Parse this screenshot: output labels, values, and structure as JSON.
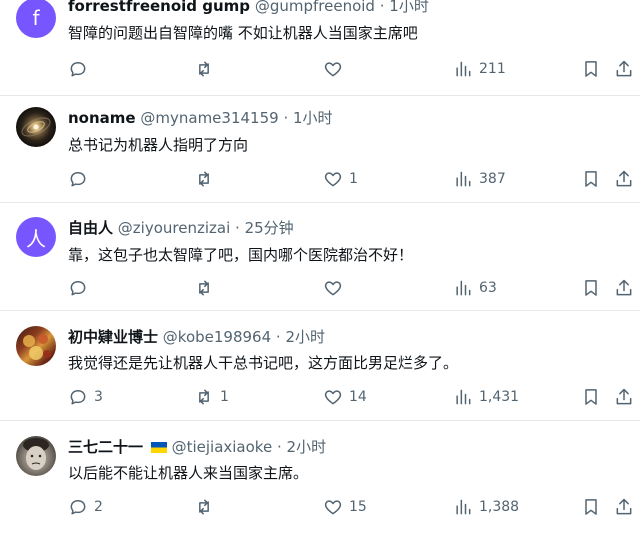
{
  "tweets": [
    {
      "name": "forrestfreenoid gump",
      "handle": "@gumpfreenoid",
      "time": "1小时",
      "avatar_letter": "f",
      "avatar_color": "#7856ff",
      "text": "智障的问题出自智障的嘴 不如让机器人当国家主席吧",
      "replies": "",
      "retweets": "",
      "likes": "",
      "views": "211"
    },
    {
      "name": "noname",
      "handle": "@myname314159",
      "time": "1小时",
      "text": "总书记为机器人指明了方向",
      "replies": "",
      "retweets": "",
      "likes": "1",
      "views": "387"
    },
    {
      "name": "自由人",
      "handle": "@ziyourenzizai",
      "time": "25分钟",
      "avatar_letter": "人",
      "avatar_color": "#7856ff",
      "text": "靠，这包子也太智障了吧，国内哪个医院都治不好！",
      "replies": "",
      "retweets": "",
      "likes": "",
      "views": "63"
    },
    {
      "name": "初中肄业博士",
      "handle": "@kobe198964",
      "time": "2小时",
      "text": "我觉得还是先让机器人干总书记吧，这方面比男足烂多了。",
      "replies": "3",
      "retweets": "1",
      "likes": "14",
      "views": "1,431"
    },
    {
      "name": "三七二十一",
      "handle": "@tiejiaxiaoke",
      "time": "2小时",
      "text": "以后能不能让机器人来当国家主席。",
      "replies": "2",
      "retweets": "",
      "likes": "15",
      "views": "1,388"
    }
  ],
  "separator": "·",
  "colors": {
    "text": "#0f1419",
    "secondary": "#536471",
    "divider": "#e6e9ec",
    "avatar_purple": "#7856ff",
    "flag_blue": "#0057b7",
    "flag_yellow": "#ffd700"
  }
}
